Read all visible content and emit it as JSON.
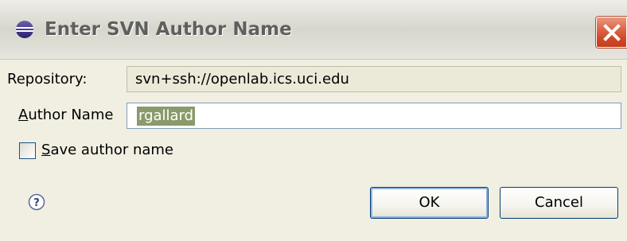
{
  "window": {
    "title": "Enter SVN Author Name",
    "icon": "eclipse-icon",
    "close_icon": "close-icon"
  },
  "form": {
    "repository_label": "Repository:",
    "repository_value": "svn+ssh://openlab.ics.uci.edu",
    "author_label_mnemonic": "A",
    "author_label_rest": "uthor Name",
    "author_value": "rgallard",
    "save_label_mnemonic": "S",
    "save_label_rest": "ave author name",
    "save_checked": false
  },
  "buttons": {
    "ok": "OK",
    "cancel": "Cancel"
  },
  "help_icon": "help-icon"
}
